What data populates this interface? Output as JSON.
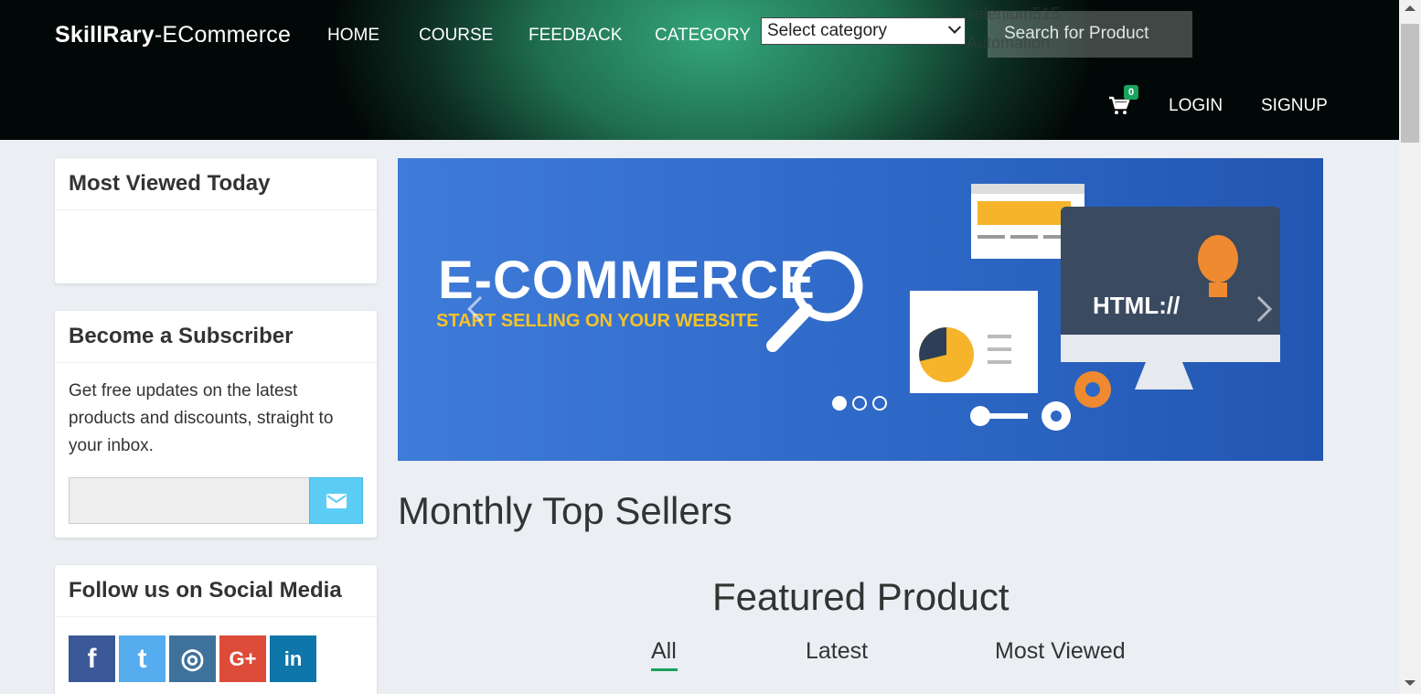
{
  "header": {
    "brand_bold": "SkillRary",
    "brand_rest": "-ECommerce",
    "nav": [
      "HOME",
      "COURSE",
      "FEEDBACK",
      "CATEGORY"
    ],
    "category_select": "Select category",
    "search_placeholder": "Search for Product",
    "ghost_line1": "selenium515",
    "ghost_line2": "Automation",
    "cart_count": "0",
    "login": "LOGIN",
    "signup": "SIGNUP"
  },
  "sidebar": {
    "most_viewed_title": "Most Viewed Today",
    "subscriber_title": "Become a Subscriber",
    "subscriber_text": "Get free updates on the latest products and discounts, straight to your inbox.",
    "social_title": "Follow us on Social Media",
    "social": [
      {
        "icon": "facebook-icon",
        "glyph": "f",
        "color": "#3b5998"
      },
      {
        "icon": "twitter-icon",
        "glyph": "t",
        "color": "#55acee"
      },
      {
        "icon": "instagram-icon",
        "glyph": "◎",
        "color": "#3f729b"
      },
      {
        "icon": "google-plus-icon",
        "glyph": "G+",
        "color": "#dd4b39"
      },
      {
        "icon": "linkedin-icon",
        "glyph": "in",
        "color": "#0e76a8"
      }
    ]
  },
  "banner": {
    "title": "E-COMMERCE",
    "subtitle": "START SELLING ON YOUR WEBSITE",
    "html_label": "HTML://",
    "slides": 3,
    "active_slide": 1
  },
  "main": {
    "monthly_title": "Monthly Top Sellers",
    "featured_title": "Featured Product",
    "tabs": [
      "All",
      "Latest",
      "Most Viewed"
    ],
    "active_tab": "All"
  },
  "colors": {
    "accent_green": "#1aa35c",
    "banner_blue": "#2e68c6",
    "subscribe_button": "#5bcdf5",
    "banner_yellow": "#f5c328"
  }
}
